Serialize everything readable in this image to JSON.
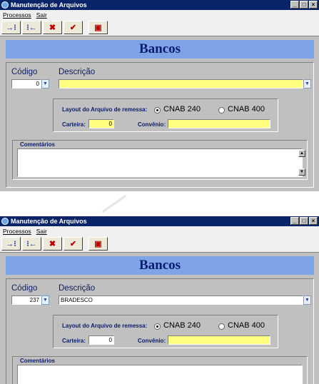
{
  "window": {
    "title": "Manutenção de Arquivos",
    "controls": [
      "_",
      "□",
      "×"
    ]
  },
  "menu": [
    "Processos",
    "Sair"
  ],
  "toolbar": {
    "buttons": [
      {
        "name": "move-right-icon",
        "glyph": "→⁝"
      },
      {
        "name": "move-left-icon",
        "glyph": "⁝←"
      },
      {
        "name": "delete-icon",
        "glyph": "✖"
      },
      {
        "name": "confirm-icon",
        "glyph": "✔"
      },
      {
        "name": "exit-icon",
        "glyph": "▣"
      }
    ]
  },
  "form": {
    "banner": "Bancos",
    "codigo_label": "Código",
    "descricao_label": "Descrição",
    "layout_label": "Layout do Arquivo de remessa:",
    "radio_cnab240": "CNAB 240",
    "radio_cnab400": "CNAB 400",
    "selected_layout": "CNAB 240",
    "carteira_label": "Carteira:",
    "convenio_label": "Convênio:",
    "comentarios_label": "Comentários"
  },
  "records": [
    {
      "codigo": "0",
      "descricao": "",
      "carteira": "0",
      "convenio": "",
      "comentarios": ""
    },
    {
      "codigo": "237",
      "descricao": "BRADESCO",
      "carteira": "0",
      "convenio": "",
      "comentarios": ""
    }
  ],
  "colors": {
    "title_bar": "#0a246a",
    "banner": "#7fa3e8",
    "field_highlight": "#ffff80",
    "label_text": "#0a1c6e"
  }
}
